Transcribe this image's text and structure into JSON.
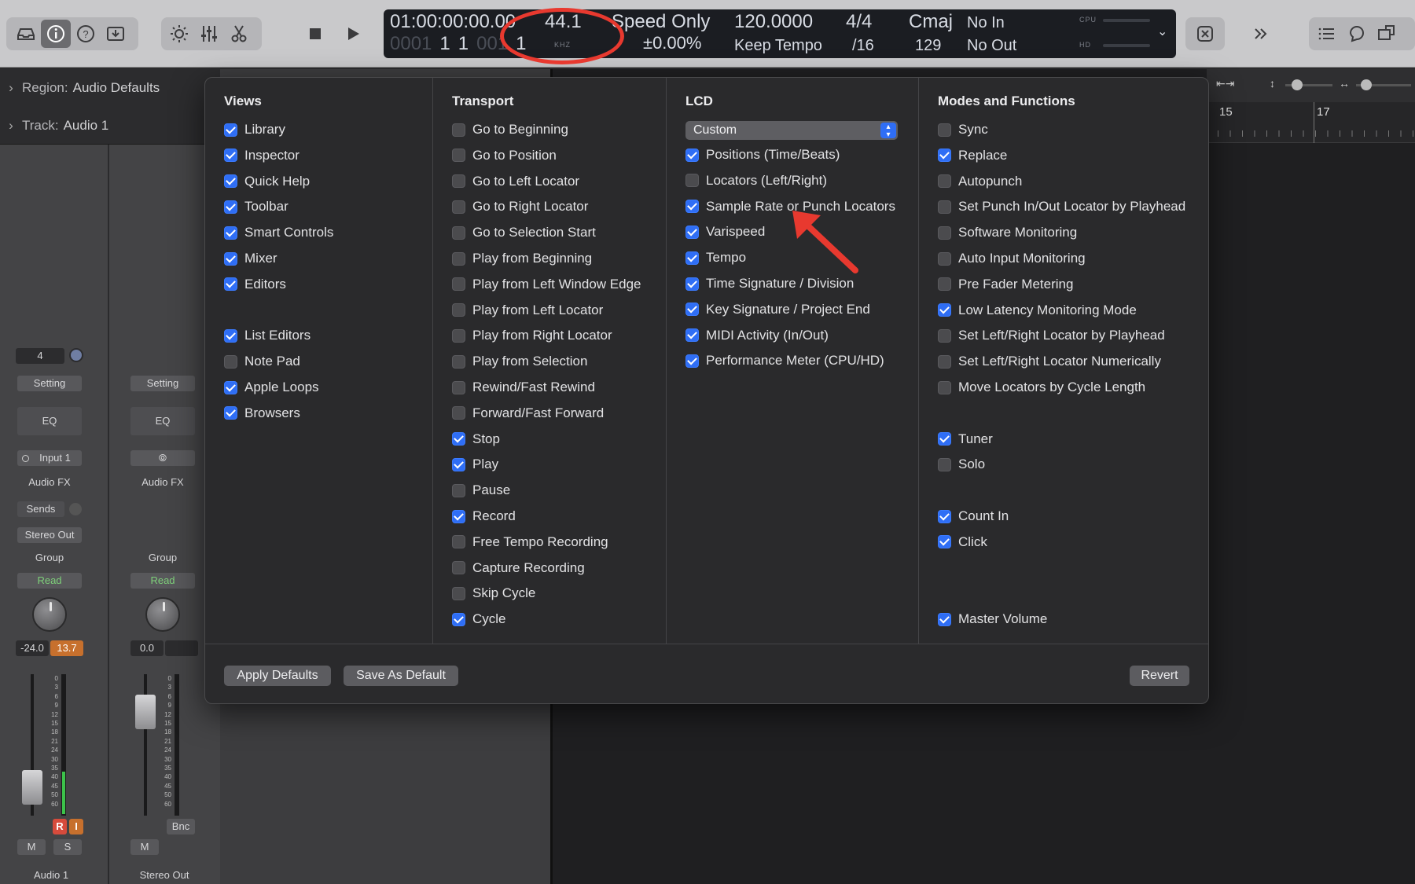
{
  "lcd": {
    "position_time": "01:00:00:00.00",
    "position_beats": [
      "0001",
      "1",
      "1",
      "001",
      "1"
    ],
    "sample_rate": "44.1",
    "sample_rate_unit": "KHZ",
    "varispeed_mode": "Speed Only",
    "varispeed_value": "±0.00",
    "varispeed_unit": "%",
    "tempo": "120.0000",
    "tempo_mode": "Keep Tempo",
    "time_signature": "4/4",
    "division": "/16",
    "key": "Cmaj",
    "project_end": "129",
    "midi_in": "No In",
    "midi_out": "No Out",
    "cpu_label": "CPU",
    "hd_label": "HD"
  },
  "inspector": {
    "region_key": "Region:",
    "region_value": "Audio Defaults",
    "track_key": "Track:",
    "track_value": "Audio 1"
  },
  "strips": [
    {
      "name": "Audio 1",
      "number": "4",
      "setting": "Setting",
      "eq": "EQ",
      "input": "Input 1",
      "audio_fx": "Audio FX",
      "sends": "Sends",
      "output": "Stereo Out",
      "group": "Group",
      "automation": "Read",
      "volume": "-24.0",
      "peak": "13.7",
      "r": "R",
      "i": "I",
      "m": "M",
      "s": "S"
    },
    {
      "name": "Stereo Out",
      "setting": "Setting",
      "eq": "EQ",
      "audio_fx": "Audio FX",
      "group": "Group",
      "automation": "Read",
      "volume": "0.0",
      "bnc": "Bnc",
      "m": "M"
    }
  ],
  "meter_scale": [
    "0",
    "3",
    "6",
    "9",
    "12",
    "15",
    "18",
    "21",
    "24",
    "30",
    "35",
    "40",
    "45",
    "50",
    "60"
  ],
  "ruler": {
    "bar_a": "15",
    "bar_b": "17"
  },
  "panel": {
    "columns": [
      {
        "title": "Views",
        "items": [
          {
            "label": "Library",
            "checked": true
          },
          {
            "label": "Inspector",
            "checked": true
          },
          {
            "label": "Quick Help",
            "checked": true
          },
          {
            "label": "Toolbar",
            "checked": true
          },
          {
            "label": "Smart Controls",
            "checked": true
          },
          {
            "label": "Mixer",
            "checked": true
          },
          {
            "label": "Editors",
            "checked": true
          },
          {
            "label": "List Editors",
            "checked": true
          },
          {
            "label": "Note Pad",
            "checked": false
          },
          {
            "label": "Apple Loops",
            "checked": true
          },
          {
            "label": "Browsers",
            "checked": true
          }
        ]
      },
      {
        "title": "Transport",
        "items": [
          {
            "label": "Go to Beginning",
            "checked": false
          },
          {
            "label": "Go to Position",
            "checked": false
          },
          {
            "label": "Go to Left Locator",
            "checked": false
          },
          {
            "label": "Go to Right Locator",
            "checked": false
          },
          {
            "label": "Go to Selection Start",
            "checked": false
          },
          {
            "label": "Play from Beginning",
            "checked": false
          },
          {
            "label": "Play from Left Window Edge",
            "checked": false
          },
          {
            "label": "Play from Left Locator",
            "checked": false
          },
          {
            "label": "Play from Right Locator",
            "checked": false
          },
          {
            "label": "Play from Selection",
            "checked": false
          },
          {
            "label": "Rewind/Fast Rewind",
            "checked": false
          },
          {
            "label": "Forward/Fast Forward",
            "checked": false
          },
          {
            "label": "Stop",
            "checked": true
          },
          {
            "label": "Play",
            "checked": true
          },
          {
            "label": "Pause",
            "checked": false
          },
          {
            "label": "Record",
            "checked": true
          },
          {
            "label": "Free Tempo Recording",
            "checked": false
          },
          {
            "label": "Capture Recording",
            "checked": false
          },
          {
            "label": "Skip Cycle",
            "checked": false
          },
          {
            "label": "Cycle",
            "checked": true
          }
        ]
      },
      {
        "title": "LCD",
        "select": "Custom",
        "items": [
          {
            "label": "Positions (Time/Beats)",
            "checked": true
          },
          {
            "label": "Locators (Left/Right)",
            "checked": false
          },
          {
            "label": "Sample Rate or Punch Locators",
            "checked": true
          },
          {
            "label": "Varispeed",
            "checked": true
          },
          {
            "label": "Tempo",
            "checked": true
          },
          {
            "label": "Time Signature / Division",
            "checked": true
          },
          {
            "label": "Key Signature / Project End",
            "checked": true
          },
          {
            "label": "MIDI Activity (In/Out)",
            "checked": true
          },
          {
            "label": "Performance Meter (CPU/HD)",
            "checked": true
          }
        ]
      },
      {
        "title": "Modes and Functions",
        "items": [
          {
            "label": "Sync",
            "checked": false
          },
          {
            "label": "Replace",
            "checked": true
          },
          {
            "label": "Autopunch",
            "checked": false
          },
          {
            "label": "Set Punch In/Out Locator by Playhead",
            "checked": false
          },
          {
            "label": "Software Monitoring",
            "checked": false
          },
          {
            "label": "Auto Input Monitoring",
            "checked": false
          },
          {
            "label": "Pre Fader Metering",
            "checked": false
          },
          {
            "label": "Low Latency Monitoring Mode",
            "checked": true
          },
          {
            "label": "Set Left/Right Locator by Playhead",
            "checked": false
          },
          {
            "label": "Set Left/Right Locator Numerically",
            "checked": false
          },
          {
            "label": "Move Locators by Cycle Length",
            "checked": false
          },
          {
            "label": "Tuner",
            "checked": true
          },
          {
            "label": "Solo",
            "checked": false
          },
          {
            "label": "Count In",
            "checked": true
          },
          {
            "label": "Click",
            "checked": true
          },
          {
            "label": "Master Volume",
            "checked": true
          }
        ]
      }
    ],
    "apply_defaults": "Apply Defaults",
    "save_as_default": "Save As Default",
    "revert": "Revert"
  },
  "colors": {
    "accent": "#2f6ef5",
    "annotation": "#e8392f",
    "read_green": "#7ed07a",
    "peak_orange": "#c7702d"
  }
}
